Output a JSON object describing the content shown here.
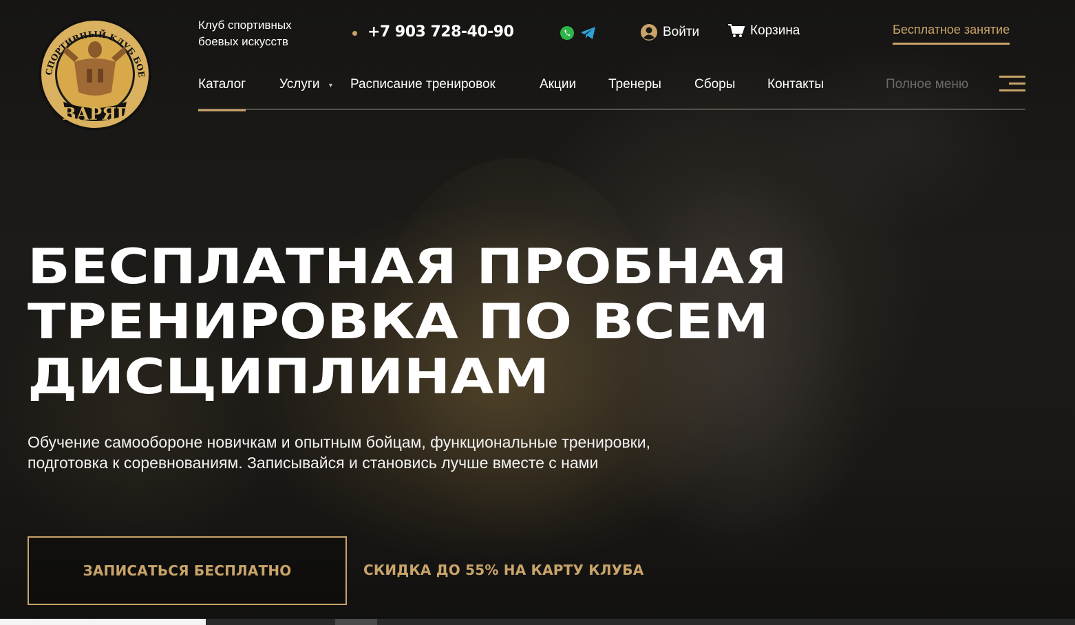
{
  "brand": {
    "logo_ring_text": "СПОРТИВНЫЙ КЛУБ БОЕВЫХ ИСКУССТВ",
    "logo_name": "ВАРЯГ",
    "tagline": "Клуб спортивных боевых искусств"
  },
  "header": {
    "phone": "+7 903 728-40-90",
    "messengers": [
      "whatsapp-icon",
      "telegram-icon"
    ],
    "login_label": "Войти",
    "cart_label": "Корзина",
    "free_lesson_label": "Бесплатное занятие"
  },
  "nav": {
    "items": [
      {
        "label": "Каталог",
        "active": true
      },
      {
        "label": "Услуги",
        "has_dropdown": true
      },
      {
        "label": "Расписание тренировок"
      },
      {
        "label": "Акции"
      },
      {
        "label": "Тренеры"
      },
      {
        "label": "Сборы"
      },
      {
        "label": "Контакты"
      }
    ],
    "full_menu_label": "Полное меню"
  },
  "hero": {
    "title": "БЕСПЛАТНАЯ ПРОБНАЯ ТРЕНИРОВКА ПО ВСЕМ ДИСЦИПЛИНАМ",
    "description": "Обучение самообороне новичкам и опытным бойцам, функциональные тренировки, подготовка к соревнованиям. Записывайся и становись лучше вместе с нами",
    "cta_label": "ЗАПИСАТЬСЯ БЕСПЛАТНО",
    "discount_label": "СКИДКА ДО 55% НА КАРТУ КЛУБА"
  },
  "colors": {
    "accent_gold": "#c9a46a",
    "background": "#1a1815",
    "text": "#ffffff",
    "muted": "#6c6a66"
  }
}
